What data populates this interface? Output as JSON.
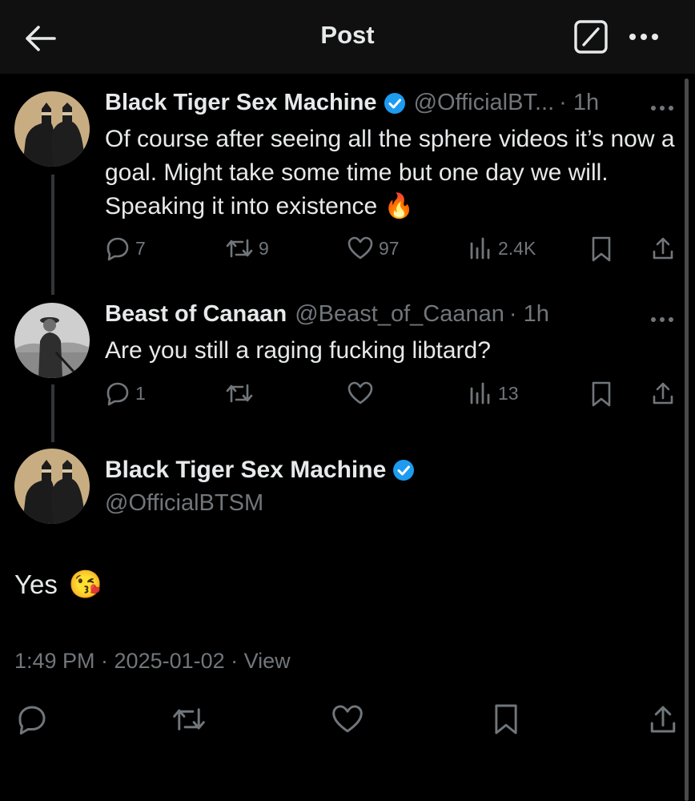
{
  "header": {
    "title": "Post",
    "back_icon": "arrow-left-icon",
    "grok_icon": "grok-icon",
    "more_icon": "more-icon"
  },
  "colors": {
    "verified": "#1d9bf0",
    "fire": "#ff7a1a",
    "muted": "#71767b"
  },
  "replies": [
    {
      "name": "Black Tiger Sex Machine",
      "verified": true,
      "handle": "@OfficialBT...",
      "time": "· 1h",
      "text": "Of course after seeing all the sphere videos it’s now a goal. Might take some time but one day we will. Speaking it into existence",
      "emoji": "🔥",
      "stats": {
        "replies": "7",
        "reposts": "9",
        "likes": "97",
        "views": "2.4K"
      }
    },
    {
      "name": "Beast of Canaan",
      "verified": false,
      "handle": "@Beast_of_Caanan",
      "time": "· 1h",
      "text": "Are you still a raging fucking libtard?",
      "stats": {
        "replies": "1",
        "reposts": "",
        "likes": "",
        "views": "13"
      }
    }
  ],
  "main_post": {
    "name": "Black Tiger Sex Machine",
    "verified": true,
    "handle": "@OfficialBTSM",
    "text": "Yes",
    "emoji": "😘",
    "timestamp": "1:49 PM · 2025-01-02 · View"
  }
}
